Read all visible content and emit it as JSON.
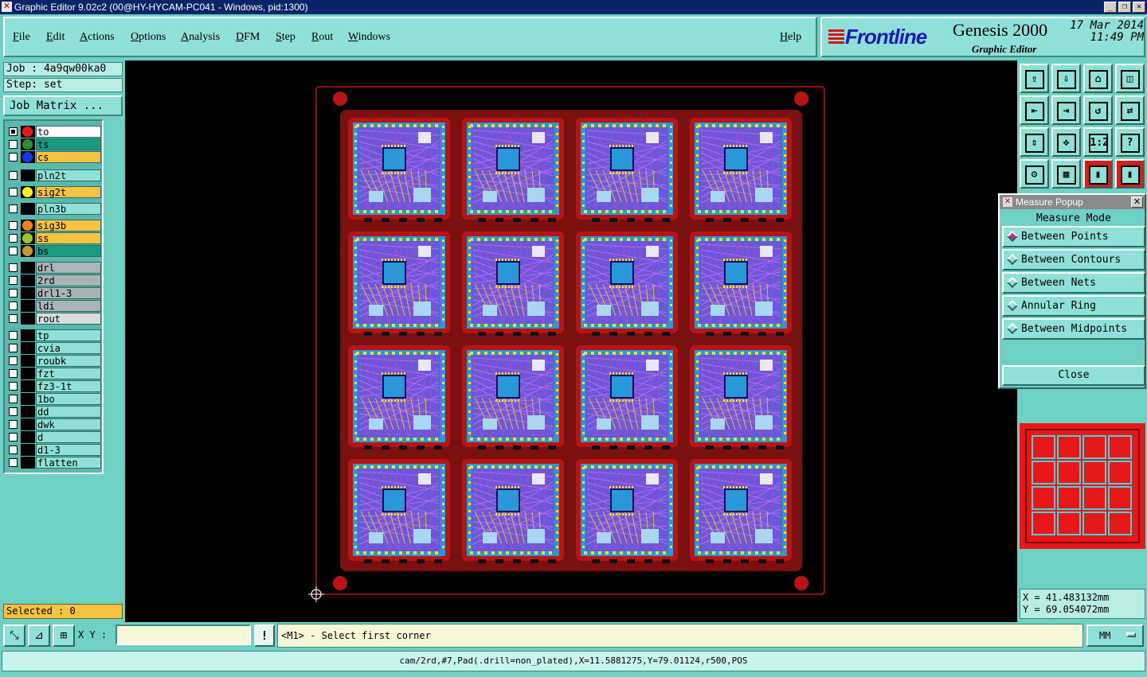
{
  "window": {
    "title": "Graphic Editor 9.02c2 (00@HY-HYCAM-PC041 - Windows, pid:1300)"
  },
  "menu": [
    "File",
    "Edit",
    "Actions",
    "Options",
    "Analysis",
    "DFM",
    "Step",
    "Rout",
    "Windows"
  ],
  "help_label": "Help",
  "brand": {
    "logo": "Frontline",
    "product": "Genesis 2000",
    "subtitle": "Graphic Editor",
    "date": "17 Mar 2014",
    "time": "11:49 PM"
  },
  "job": {
    "job_line": "Job : 4a9qw00ka0",
    "step_line": "Step: set",
    "matrix_button": "Job Matrix ..."
  },
  "layers": [
    {
      "name": "to",
      "color": "#e81818",
      "bg": "#ffffff",
      "checked": true
    },
    {
      "name": "ts",
      "color": "#2e8b2e",
      "bg": "#1a9a80",
      "checked": false
    },
    {
      "name": "cs",
      "color": "#1838e8",
      "bg": "#f5c242",
      "checked": false
    },
    {
      "name": "pln2t",
      "color": "",
      "bg": "#8fe0d6",
      "checked": false
    },
    {
      "name": "sig2t",
      "color": "#f8f020",
      "bg": "#f5c242",
      "checked": false
    },
    {
      "name": "pln3b",
      "color": "",
      "bg": "#8fe0d6",
      "checked": false
    },
    {
      "name": "sig3b",
      "color": "#f08020",
      "bg": "#f5c242",
      "checked": false
    },
    {
      "name": "ss",
      "color": "#98c828",
      "bg": "#f5c242",
      "checked": false
    },
    {
      "name": "bs",
      "color": "#c89828",
      "bg": "#1a9a80",
      "checked": false
    },
    {
      "name": "drl",
      "color": "",
      "bg": "#a8b4b8",
      "checked": false
    },
    {
      "name": "2rd",
      "color": "",
      "bg": "#a8b4b8",
      "checked": false
    },
    {
      "name": "drl1-3",
      "color": "",
      "bg": "#a8b4b8",
      "checked": false
    },
    {
      "name": "ldi",
      "color": "",
      "bg": "#a8b4b8",
      "checked": false
    },
    {
      "name": "rout",
      "color": "",
      "bg": "#d8dcdc",
      "checked": false
    },
    {
      "name": "tp",
      "color": "",
      "bg": "#8fe0d6",
      "checked": false
    },
    {
      "name": "cvia",
      "color": "",
      "bg": "#8fe0d6",
      "checked": false
    },
    {
      "name": "roubk",
      "color": "",
      "bg": "#8fe0d6",
      "checked": false
    },
    {
      "name": "fzt",
      "color": "",
      "bg": "#8fe0d6",
      "checked": false
    },
    {
      "name": "fz3-1t",
      "color": "",
      "bg": "#8fe0d6",
      "checked": false
    },
    {
      "name": "1bo",
      "color": "",
      "bg": "#8fe0d6",
      "checked": false
    },
    {
      "name": "dd",
      "color": "",
      "bg": "#8fe0d6",
      "checked": false
    },
    {
      "name": "dwk",
      "color": "",
      "bg": "#8fe0d6",
      "checked": false
    },
    {
      "name": "d",
      "color": "",
      "bg": "#8fe0d6",
      "checked": false
    },
    {
      "name": "d1-3",
      "color": "",
      "bg": "#8fe0d6",
      "checked": false
    },
    {
      "name": "flatten",
      "color": "",
      "bg": "#8fe0d6",
      "checked": false
    }
  ],
  "selected": "Selected : 0",
  "toolbar_icons": [
    "zoom-home-icon",
    "zoom-down-icon",
    "home-icon",
    "split-view-icon",
    "pan-left-icon",
    "pan-right-icon",
    "reverse-icon",
    "swap-icon",
    "fit-vertical-icon",
    "zoom-center-icon",
    "one-to-two-icon",
    "help-icon",
    "settings-icon",
    "grid-icon",
    "layers-red-icon",
    "layers-toggle-icon"
  ],
  "measure": {
    "title": "Measure Popup",
    "mode_label": "Measure Mode",
    "options": [
      "Between Points",
      "Between Contours",
      "Between Nets",
      "Annular Ring",
      "Between Midpoints"
    ],
    "selected_index": 0,
    "close_label": "Close"
  },
  "coords": {
    "x": "X =  41.483132mm",
    "y": "Y =  69.054072mm"
  },
  "command": {
    "xy_label": "X Y :",
    "xy_value": "",
    "bang": "!",
    "prompt": "<M1> - Select first corner",
    "units": "MM"
  },
  "status": "cam/2rd,#7,Pad(.drill=non_plated),X=11.5881275,Y=79.01124,r500,POS",
  "panel": {
    "rows": 4,
    "cols": 4
  },
  "colors": {
    "board_border": "#7a1010",
    "panel_fill": "#b81414",
    "copper_blue": "#2898d8",
    "trace_purple": "#9a4cd8",
    "pad_yellow": "#f0e020"
  }
}
